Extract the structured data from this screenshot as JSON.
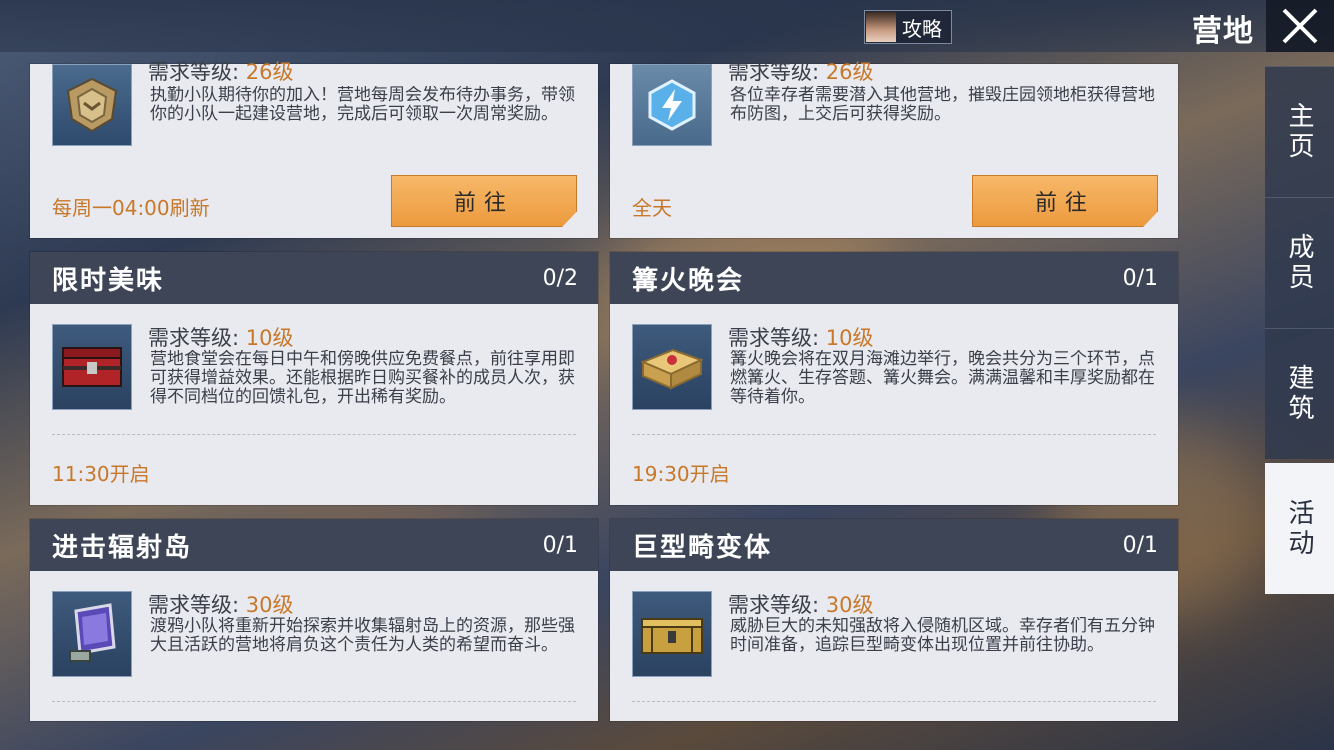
{
  "header": {
    "guide_label": "攻略",
    "title": "营地"
  },
  "sidebar": {
    "tabs": [
      {
        "label": "主页",
        "active": false
      },
      {
        "label": "成员",
        "active": false
      },
      {
        "label": "建筑",
        "active": false
      },
      {
        "label": "活动",
        "active": true
      }
    ]
  },
  "cards": [
    {
      "title": "",
      "count": "",
      "req_label": "需求等级:",
      "req_level": "26级",
      "desc": "执勤小队期待你的加入！营地每周会发布待办事务，带领你的小队一起建设营地，完成后可领取一次周常奖励。",
      "time": "每周一04:00刷新",
      "button": "前往",
      "icon": "badge-icon"
    },
    {
      "title": "",
      "count": "",
      "req_label": "需求等级:",
      "req_level": "26级",
      "desc": "各位幸存者需要潜入其他营地，摧毁庄园领地柜获得营地布防图，上交后可获得奖励。",
      "time": "全天",
      "button": "前往",
      "icon": "lightning-icon"
    },
    {
      "title": "限时美味",
      "count": "0/2",
      "req_label": "需求等级:",
      "req_level": "10级",
      "desc": "营地食堂会在每日中午和傍晚供应免费餐点，前往享用即可获得增益效果。还能根据昨日购买餐补的成员人次，获得不同档位的回馈礼包，开出稀有奖励。",
      "time": "11:30开启",
      "icon": "red-chest-icon"
    },
    {
      "title": "篝火晚会",
      "count": "0/1",
      "req_label": "需求等级:",
      "req_level": "10级",
      "desc": "篝火晚会将在双月海滩边举行，晚会共分为三个环节，点燃篝火、生存答题、篝火舞会。满满温馨和丰厚奖励都在等待着你。",
      "time": "19:30开启",
      "icon": "gift-box-icon"
    },
    {
      "title": "进击辐射岛",
      "count": "0/1",
      "req_label": "需求等级:",
      "req_level": "30级",
      "desc": "渡鸦小队将重新开始探索并收集辐射岛上的资源，那些强大且活跃的营地将肩负这个责任为人类的希望而奋斗。",
      "icon": "card-device-icon"
    },
    {
      "title": "巨型畸变体",
      "count": "0/1",
      "req_label": "需求等级:",
      "req_level": "30级",
      "desc": "威胁巨大的未知强敌将入侵随机区域。幸存者们有五分钟时间准备，追踪巨型畸变体出现位置并前往协助。",
      "icon": "gold-crate-icon"
    }
  ]
}
